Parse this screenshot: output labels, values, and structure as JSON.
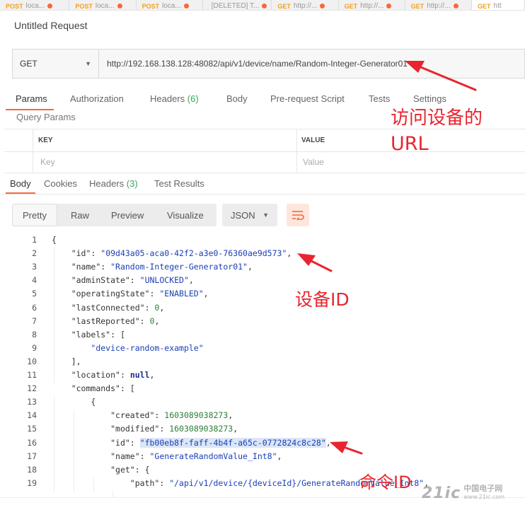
{
  "tabs": [
    {
      "method": "POST",
      "label": "loca...",
      "dot": true
    },
    {
      "method": "POST",
      "label": "loca...",
      "dot": true
    },
    {
      "method": "POST",
      "label": "loca...",
      "dot": true
    },
    {
      "method": "",
      "label": "[DELETED] T...",
      "dot": true
    },
    {
      "method": "GET",
      "label": "http://...",
      "dot": true
    },
    {
      "method": "GET",
      "label": "http://...",
      "dot": true
    },
    {
      "method": "GET",
      "label": "http://...",
      "dot": true
    },
    {
      "method": "GET",
      "label": "htt",
      "dot": false
    }
  ],
  "request": {
    "title": "Untitled Request",
    "method": "GET",
    "url": "http://192.168.138.128:48082/api/v1/device/name/Random-Integer-Generator01"
  },
  "request_tabs": [
    {
      "label": "Params",
      "count": ""
    },
    {
      "label": "Authorization",
      "count": ""
    },
    {
      "label": "Headers",
      "count": "(6)"
    },
    {
      "label": "Body",
      "count": ""
    },
    {
      "label": "Pre-request Script",
      "count": ""
    },
    {
      "label": "Tests",
      "count": ""
    },
    {
      "label": "Settings",
      "count": ""
    }
  ],
  "query_params": {
    "title": "Query Params",
    "col_key": "KEY",
    "col_value": "VALUE",
    "key_placeholder": "Key",
    "value_placeholder": "Value"
  },
  "response_tabs": [
    {
      "label": "Body",
      "count": ""
    },
    {
      "label": "Cookies",
      "count": ""
    },
    {
      "label": "Headers",
      "count": "(3)"
    },
    {
      "label": "Test Results",
      "count": ""
    }
  ],
  "view_modes": [
    "Pretty",
    "Raw",
    "Preview",
    "Visualize"
  ],
  "format": "JSON",
  "code_lines": [
    {
      "n": "1",
      "t": "{"
    },
    {
      "n": "2",
      "t": "    \"id\": \"09d43a05-aca0-42f2-a3e0-76360ae9d573\","
    },
    {
      "n": "3",
      "t": "    \"name\": \"Random-Integer-Generator01\","
    },
    {
      "n": "4",
      "t": "    \"adminState\": \"UNLOCKED\","
    },
    {
      "n": "5",
      "t": "    \"operatingState\": \"ENABLED\","
    },
    {
      "n": "6",
      "t": "    \"lastConnected\": 0,"
    },
    {
      "n": "7",
      "t": "    \"lastReported\": 0,"
    },
    {
      "n": "8",
      "t": "    \"labels\": ["
    },
    {
      "n": "9",
      "t": "        \"device-random-example\""
    },
    {
      "n": "10",
      "t": "    ],"
    },
    {
      "n": "11",
      "t": "    \"location\": null,"
    },
    {
      "n": "12",
      "t": "    \"commands\": ["
    },
    {
      "n": "13",
      "t": "        {"
    },
    {
      "n": "14",
      "t": "            \"created\": 1603089038273,"
    },
    {
      "n": "15",
      "t": "            \"modified\": 1603089038273,"
    },
    {
      "n": "16",
      "t": "            \"id\": \"fb00eb8f-faff-4b4f-a65c-0772824c8c28\","
    },
    {
      "n": "17",
      "t": "            \"name\": \"GenerateRandomValue_Int8\","
    },
    {
      "n": "18",
      "t": "            \"get\": {"
    },
    {
      "n": "19",
      "t": "                \"path\": \"/api/v1/device/{deviceId}/GenerateRandomValue_Int8\","
    }
  ],
  "annotations": {
    "url_note_1": "访问设备的",
    "url_note_2": "URL",
    "device_id_note": "设备ID",
    "command_id_note": "命令ID",
    "color": "#e8252f"
  },
  "watermark": {
    "big": "21ic",
    "line1": "中国电子网",
    "line2": "www.21ic.com"
  }
}
